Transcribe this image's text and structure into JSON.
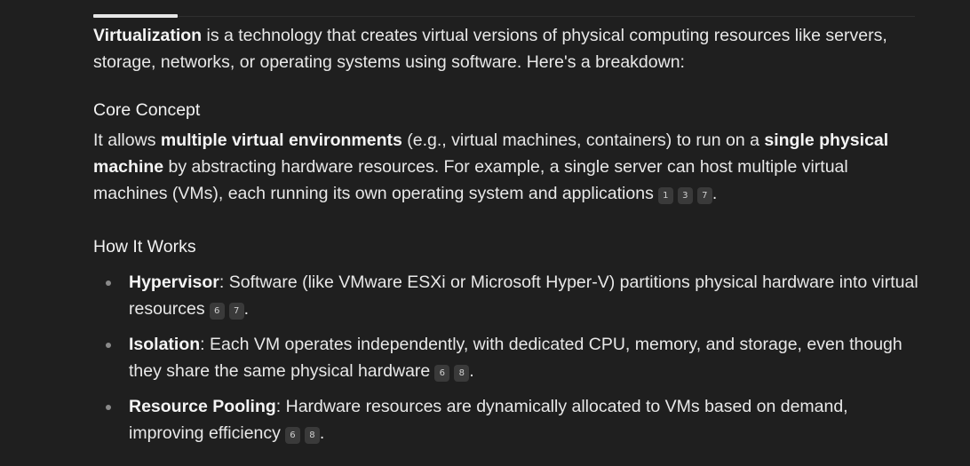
{
  "intro": {
    "term": "Virtualization",
    "text": " is a technology that creates virtual versions of physical computing resources like servers, storage, networks, or operating systems using software. Here's a breakdown:"
  },
  "core": {
    "heading": "Core Concept",
    "p1": "It allows ",
    "b1": "multiple virtual environments",
    "p2": " (e.g., virtual machines, containers) to run on a ",
    "b2": "single physical machine",
    "p3": " by abstracting hardware resources. For example, a single server can host multiple virtual machines (VMs), each running its own operating system and applications",
    "citations": [
      "1",
      "3",
      "7"
    ],
    "end": "."
  },
  "how": {
    "heading": "How It Works",
    "items": [
      {
        "term": "Hypervisor",
        "text": ": Software (like VMware ESXi or Microsoft Hyper-V) partitions physical hardware into virtual resources",
        "citations": [
          "6",
          "7"
        ],
        "end": "."
      },
      {
        "term": "Isolation",
        "text": ": Each VM operates independently, with dedicated CPU, memory, and storage, even though they share the same physical hardware",
        "citations": [
          "6",
          "8"
        ],
        "end": "."
      },
      {
        "term": "Resource Pooling",
        "text": ": Hardware resources are dynamically allocated to VMs based on demand, improving efficiency",
        "citations": [
          "6",
          "8"
        ],
        "end": "."
      }
    ]
  }
}
